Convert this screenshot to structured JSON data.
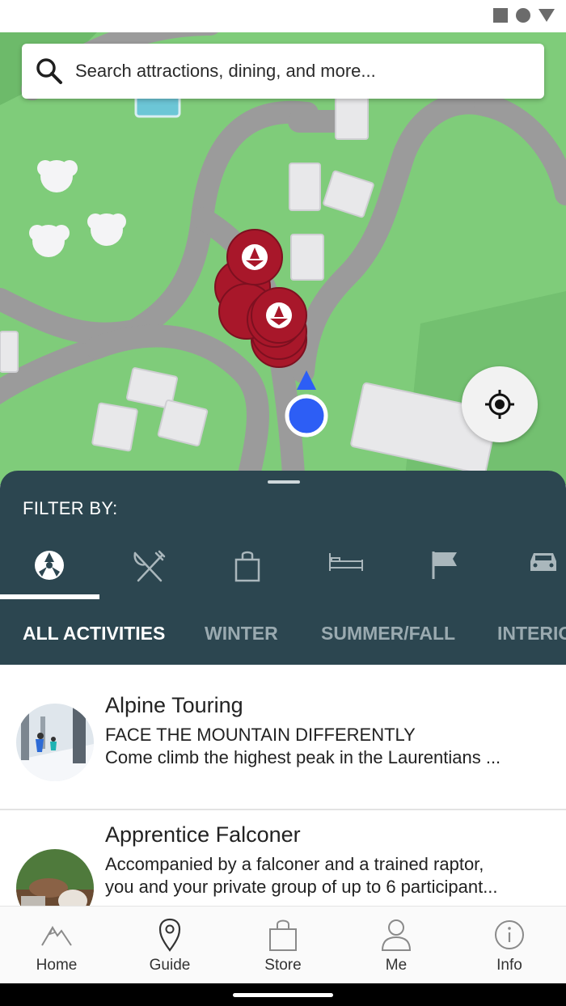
{
  "search": {
    "placeholder": "Search attractions, dining, and more..."
  },
  "panel": {
    "filter_title": "FILTER BY:",
    "categories": [
      {
        "icon": "activities-icon",
        "selected": true
      },
      {
        "icon": "dining-icon",
        "selected": false
      },
      {
        "icon": "shopping-bag-icon",
        "selected": false
      },
      {
        "icon": "bed-icon",
        "selected": false
      },
      {
        "icon": "flag-icon",
        "selected": false
      },
      {
        "icon": "car-icon",
        "selected": false
      }
    ],
    "subtabs": [
      {
        "label": "ALL ACTIVITIES",
        "active": true
      },
      {
        "label": "WINTER",
        "active": false
      },
      {
        "label": "SUMMER/FALL",
        "active": false
      },
      {
        "label": "INTERIO",
        "active": false
      }
    ]
  },
  "list": [
    {
      "title": "Alpine Touring",
      "line1": "FACE THE MOUNTAIN DIFFERENTLY",
      "line2": "Come climb the highest peak in the Laurentians ..."
    },
    {
      "title": "Apprentice Falconer",
      "line1": "Accompanied by a falconer and a trained raptor,",
      "line2": "you and your private group of up to 6 participant..."
    }
  ],
  "nav": {
    "items": [
      {
        "label": "Home",
        "icon": "mountain-icon"
      },
      {
        "label": "Guide",
        "icon": "map-pin-icon"
      },
      {
        "label": "Store",
        "icon": "shopping-bag-icon"
      },
      {
        "label": "Me",
        "icon": "user-icon"
      },
      {
        "label": "Info",
        "icon": "info-icon"
      }
    ]
  },
  "colors": {
    "panel_bg": "#2c4650",
    "marker_red": "#a8172a",
    "user_location_blue": "#2d5ef5",
    "map_green": "#7fcc7a",
    "map_road": "#9b9b9b"
  }
}
